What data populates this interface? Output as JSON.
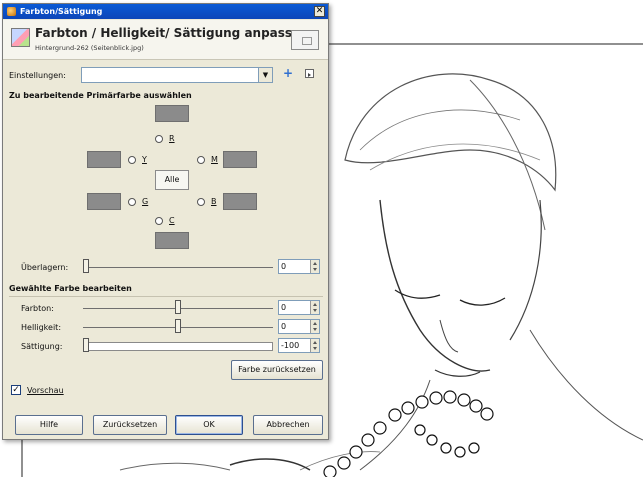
{
  "dialog": {
    "title": "Farbton/Sättigung",
    "close_glyph": "✕",
    "header_title": "Farbton / Helligkeit/ Sättigung anpassen",
    "header_subtitle": "Hintergrund-262 (Seitenblick.jpg)"
  },
  "presets": {
    "label": "Einstellungen:",
    "value": "",
    "add_icon": "plus-icon",
    "menu_icon": "menu-arrow-icon"
  },
  "primary": {
    "heading": "Zu bearbeitende Primärfarbe auswählen",
    "colors": {
      "r": "R",
      "y": "Y",
      "m": "M",
      "g": "G",
      "b": "B",
      "c": "C"
    },
    "all_label": "Alle",
    "overlap_label": "Überlagern:",
    "overlap_value": "0",
    "overlap_level": 0
  },
  "edit": {
    "heading": "Gewählte Farbe bearbeiten",
    "hue_label": "Farbton:",
    "hue_value": "0",
    "hue_level": 0.5,
    "lightness_label": "Helligkeit:",
    "lightness_value": "0",
    "lightness_level": 0.5,
    "saturation_label": "Sättigung:",
    "saturation_value": "-100",
    "saturation_level": 0.0,
    "reset_color_label": "Farbe zurücksetzen"
  },
  "preview": {
    "label": "Vorschau",
    "checked": true,
    "check_glyph": "✓"
  },
  "buttons": {
    "help": "Hilfe",
    "reset": "Zurücksetzen",
    "ok": "OK",
    "cancel": "Abbrechen"
  },
  "colors": {
    "swatch": "#8b8b8b",
    "titlebar": "#0a5ad6",
    "dialog_bg": "#ece9d8"
  }
}
